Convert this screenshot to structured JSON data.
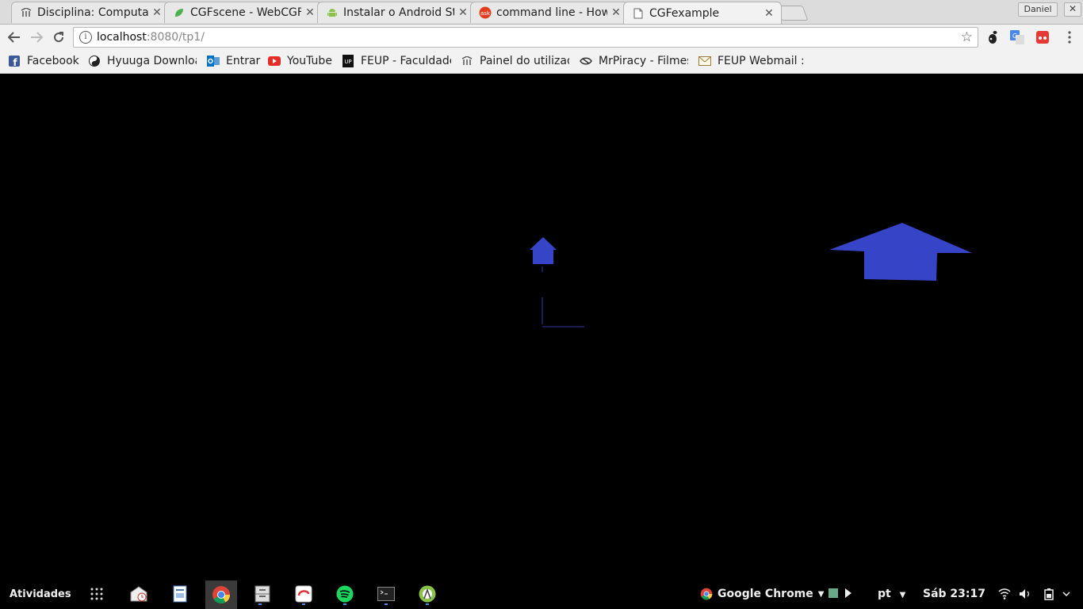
{
  "tabs": [
    {
      "title": "Disciplina: Computaç",
      "icon": "feup-icon"
    },
    {
      "title": "CGFscene - WebCGF",
      "icon": "leaf-icon"
    },
    {
      "title": "Instalar o Android St",
      "icon": "android-icon"
    },
    {
      "title": "command line - How",
      "icon": "askubuntu-icon"
    },
    {
      "title": "CGFexample",
      "icon": "page-icon",
      "active": true
    }
  ],
  "window": {
    "profile_name": "Daniel",
    "close": "✕"
  },
  "toolbar": {
    "url_host": "localhost",
    "url_rest": ":8080/tp1/"
  },
  "bookmarks": [
    {
      "label": "Facebook",
      "icon": "facebook-icon"
    },
    {
      "label": "Hyuuga Downloa",
      "icon": "yin-yang-icon"
    },
    {
      "label": "Entrar",
      "icon": "outlook-icon"
    },
    {
      "label": "YouTube",
      "icon": "youtube-icon"
    },
    {
      "label": "FEUP - Faculdade",
      "icon": "up-icon"
    },
    {
      "label": "Painel do utilizad",
      "icon": "feup-icon"
    },
    {
      "label": "MrPiracy - Filmes",
      "icon": "mrpiracy-icon"
    },
    {
      "label": "FEUP Webmail ::",
      "icon": "mail-icon"
    }
  ],
  "scene": {
    "shape_color": "#3645c8"
  },
  "taskbar": {
    "activities": "Atividades",
    "app_menu": "Google Chrome",
    "language": "pt",
    "clock": "Sáb 23:17"
  }
}
